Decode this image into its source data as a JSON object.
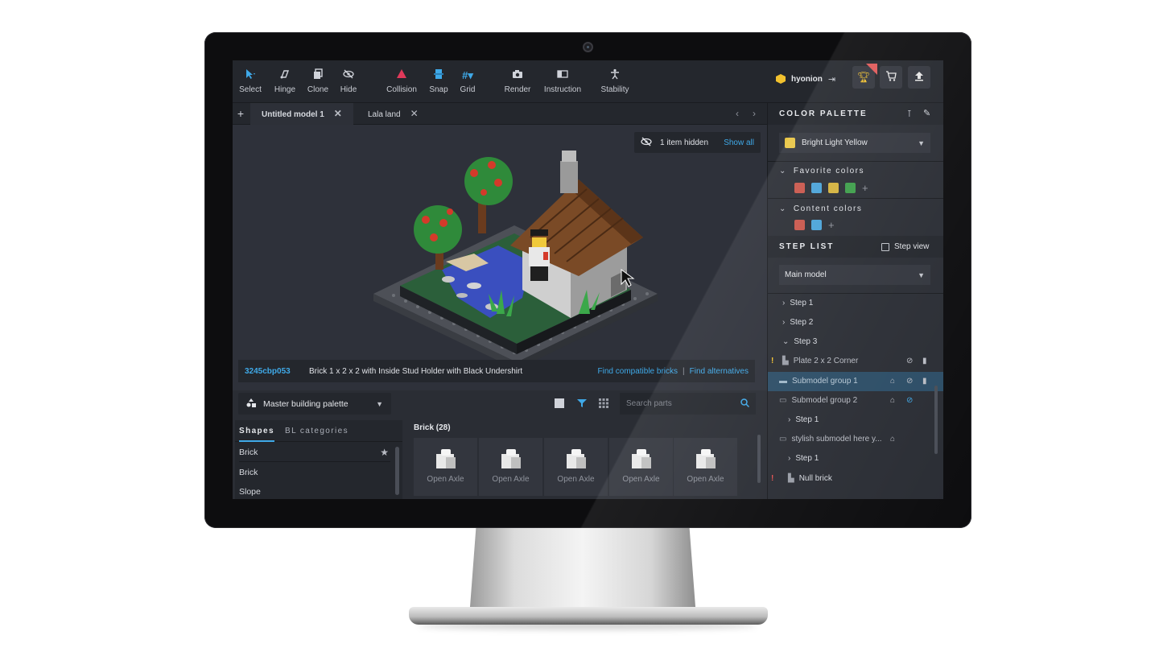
{
  "colors": {
    "accent": "#3fa9e8",
    "bright_light_yellow": "#e8c545",
    "red_swatch": "#c9564b",
    "blue_swatch": "#4aa3d8",
    "yellow_swatch": "#d4b23d",
    "green_swatch": "#3d9e4a"
  },
  "toolbar": {
    "tools": [
      {
        "label": "Select",
        "icon": "cursor-icon"
      },
      {
        "label": "Hinge",
        "icon": "hinge-icon"
      },
      {
        "label": "Clone",
        "icon": "clone-icon"
      },
      {
        "label": "Hide",
        "icon": "eye-off-icon"
      },
      {
        "label": "Collision",
        "icon": "warning-triangle-icon"
      },
      {
        "label": "Snap",
        "icon": "snap-icon"
      },
      {
        "label": "Grid",
        "icon": "grid-icon"
      },
      {
        "label": "Render",
        "icon": "camera-icon"
      },
      {
        "label": "Instruction",
        "icon": "book-icon"
      },
      {
        "label": "Stability",
        "icon": "stability-icon"
      }
    ],
    "username": "hyonion"
  },
  "tabs": [
    {
      "label": "Untitled model 1",
      "active": true
    },
    {
      "label": "Lala land",
      "active": false
    }
  ],
  "viewport": {
    "hidden_count_text": "1 item hidden",
    "show_all": "Show all"
  },
  "infobar": {
    "part_code": "3245cbp053",
    "part_desc": "Brick 1 x 2 x 2 with Inside Stud Holder with Black Undershirt",
    "find_compatible": "Find compatible bricks",
    "separator": "|",
    "find_alternatives": "Find alternatives"
  },
  "parts": {
    "palette_label": "Master building palette",
    "search_placeholder": "Search parts",
    "tabs": [
      "Shapes",
      "BL categories"
    ],
    "list": [
      "Brick",
      "Brick",
      "Slope"
    ],
    "category_title": "Brick (28)",
    "cards": [
      "Open Axle",
      "Open Axle",
      "Open Axle",
      "Open Axle",
      "Open Axle"
    ]
  },
  "color_palette": {
    "title": "COLOR PALETTE",
    "selected_color": "Bright Light Yellow",
    "favorite_title": "Favorite colors",
    "content_title": "Content colors"
  },
  "step_list": {
    "title": "STEP LIST",
    "step_view": "Step view",
    "model_select": "Main model",
    "rows": [
      {
        "label": "Step 1"
      },
      {
        "label": "Step 2"
      },
      {
        "label": "Step 3"
      },
      {
        "label": "Plate 2 x 2 Corner",
        "status": "!"
      },
      {
        "label": "Submodel group 1"
      },
      {
        "label": "Submodel group 2"
      },
      {
        "label": "Step 1"
      },
      {
        "label": "stylish submodel here y..."
      },
      {
        "label": "Step 1"
      },
      {
        "label": "Null brick",
        "status": "!"
      }
    ]
  }
}
